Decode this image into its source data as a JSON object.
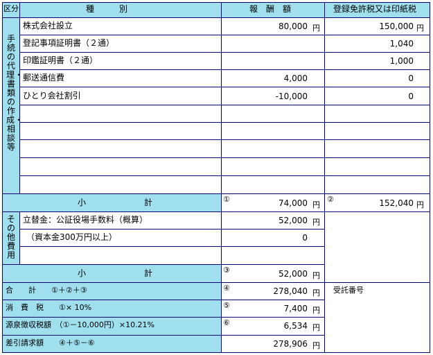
{
  "header": {
    "kubun": "区分",
    "shubetsu": "種　　　別",
    "hoshu": "報　酬　額",
    "tax": "登録免許税又は印紙税"
  },
  "section1": {
    "label": "手続の代理・書類の作成・相談等",
    "rows": [
      {
        "item": "株式会社設立",
        "fee": "80,000",
        "fee_yen": "円",
        "tax": "150,000",
        "tax_yen": "円"
      },
      {
        "item": "登記事項証明書（２通）",
        "fee": "",
        "fee_yen": "",
        "tax": "1,040",
        "tax_yen": ""
      },
      {
        "item": "印鑑証明書（２通）",
        "fee": "",
        "fee_yen": "",
        "tax": "1,000",
        "tax_yen": ""
      },
      {
        "item": "郵送通信費",
        "fee": "4,000",
        "fee_yen": "",
        "tax": "0",
        "tax_yen": ""
      },
      {
        "item": "ひとり会社割引",
        "fee": "-10,000",
        "fee_yen": "",
        "tax": "0",
        "tax_yen": ""
      }
    ],
    "subtotal_label": "小　　　　　　　計",
    "subtotal_fee_mark": "①",
    "subtotal_fee": "74,000",
    "subtotal_fee_yen": "円",
    "subtotal_tax_mark": "②",
    "subtotal_tax": "152,040",
    "subtotal_tax_yen": "円"
  },
  "section2": {
    "label": "その他費用",
    "rows": [
      {
        "item": "立替金：公証役場手数料（概算）",
        "fee": "52,000",
        "fee_yen": "円"
      },
      {
        "item": "（資本金300万円以上）",
        "fee": "0",
        "fee_yen": ""
      }
    ],
    "subtotal_label": "小　　　　　　　計",
    "subtotal_mark": "③",
    "subtotal_fee": "52,000",
    "subtotal_yen": "円"
  },
  "totals": [
    {
      "label": "合　　計　　①＋②＋③",
      "mark": "④",
      "value": "278,040",
      "yen": "円"
    },
    {
      "label": "消　費　税　　①× 10%",
      "mark": "⑤",
      "value": "7,400",
      "yen": "円"
    },
    {
      "label": "源泉徴収税額　（①－10,000円）×10.21%",
      "mark": "⑥",
      "value": "6,534",
      "yen": "円"
    },
    {
      "label": "差引請求額　　④＋⑤－⑥",
      "mark": "",
      "value": "278,906",
      "yen": "円"
    }
  ],
  "receipt_label": "受託番号",
  "colors": {
    "header_bg": "#9fdfee",
    "border": "#00007a"
  }
}
